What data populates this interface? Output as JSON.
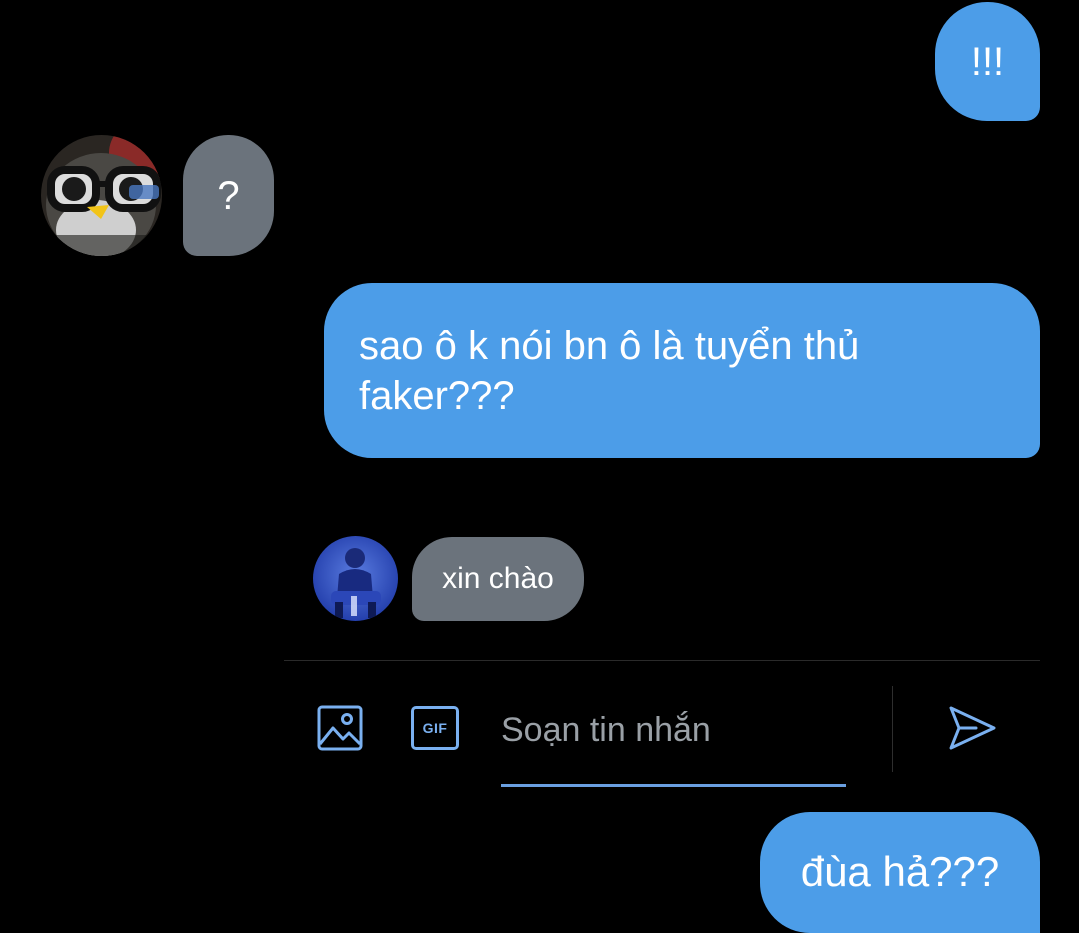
{
  "colors": {
    "background": "#000000",
    "outgoing_bubble": "#4c9de8",
    "incoming_bubble": "#6b737c",
    "accent": "#7ab0f0",
    "placeholder": "#9aa0a6"
  },
  "messages": [
    {
      "direction": "outgoing",
      "text": "!!!"
    },
    {
      "direction": "incoming",
      "text": "?",
      "avatar_icon": "penguin-avatar"
    },
    {
      "direction": "outgoing",
      "text": "sao ô k nói bn ô là tuyển thủ faker???"
    },
    {
      "direction": "incoming",
      "text": "xin chào",
      "avatar_icon": "person-avatar"
    },
    {
      "direction": "outgoing",
      "text": "đùa hả???"
    }
  ],
  "composer": {
    "image_icon": "image-icon",
    "gif_icon": "gif-icon",
    "gif_label": "GIF",
    "placeholder": "Soạn tin nhắn",
    "value": "",
    "send_icon": "send-icon"
  }
}
